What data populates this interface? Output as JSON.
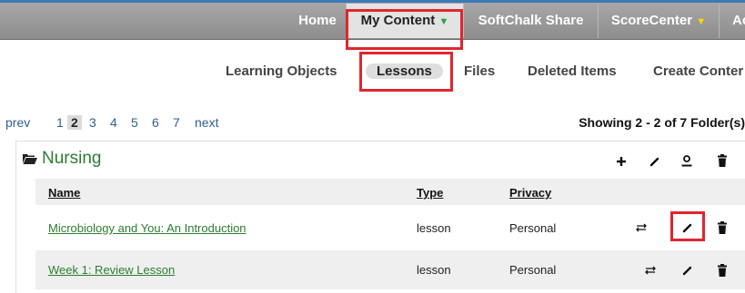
{
  "top_nav": {
    "items": [
      {
        "label": "Home"
      },
      {
        "label": "My Content",
        "caret": "▼"
      },
      {
        "label": "SoftChalk Share"
      },
      {
        "label": "ScoreCenter",
        "caret": "▼"
      },
      {
        "label": "Ac"
      }
    ]
  },
  "sub_nav": {
    "items": [
      {
        "label": "Learning Objects"
      },
      {
        "label": "Lessons"
      },
      {
        "label": "Files"
      },
      {
        "label": "Deleted Items"
      },
      {
        "label": "Create Conter"
      }
    ]
  },
  "pagination": {
    "prev": "prev",
    "pages": [
      "1",
      "2",
      "3",
      "4",
      "5",
      "6",
      "7"
    ],
    "current": "2",
    "next": "next",
    "showing": "Showing 2 - 2 of 7 Folder(s)"
  },
  "folder": {
    "name": "Nursing",
    "icons": [
      "plus-icon",
      "pencil-icon",
      "user-icon",
      "trash-icon"
    ],
    "columns": {
      "name": "Name",
      "type": "Type",
      "privacy": "Privacy"
    },
    "rows": [
      {
        "name": "Microbiology and You: An Introduction",
        "type": "lesson",
        "privacy": "Personal"
      },
      {
        "name": "Week 1: Review Lesson",
        "type": "lesson",
        "privacy": "Personal"
      }
    ]
  },
  "colors": {
    "nav_bg": "#9a9a9a",
    "active_tab": "#e3e3e3",
    "highlight": "#e0262e",
    "folder_green": "#2e7d32",
    "caret_green": "#2e9e3e",
    "caret_yellow": "#ffd700"
  }
}
